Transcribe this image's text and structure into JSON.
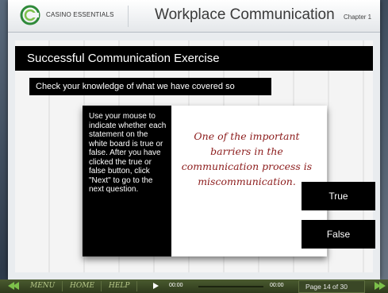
{
  "header": {
    "brand": "CASINO ESSENTIALS",
    "course_title": "Workplace Communication",
    "chapter": "Chapter 1"
  },
  "slide": {
    "title": "Successful Communication Exercise",
    "subtitle": "Check your knowledge of what we have covered so",
    "instructions": "Use your mouse to indicate whether each statement on the white board is true or false. After you have clicked the true or false button, click \"Next\" to go to the next question.",
    "statement": "One of the important barriers in the communication process is miscommunication.",
    "true_label": "True",
    "false_label": "False"
  },
  "footer": {
    "menu": "MENU",
    "home": "HOME",
    "help": "HELP",
    "time_current": "00:00",
    "time_total": "00:00",
    "progress": 0,
    "page_indicator": "Page 14 of 30"
  },
  "icons": {
    "logo": "casino-essentials-logo",
    "back": "double-arrow-left-icon",
    "next": "double-arrow-right-icon",
    "play": "play-icon"
  },
  "colors": {
    "accent_green": "#7cc04a",
    "statement_red": "#8b1a1a",
    "footer_bg": "#3a4726"
  }
}
